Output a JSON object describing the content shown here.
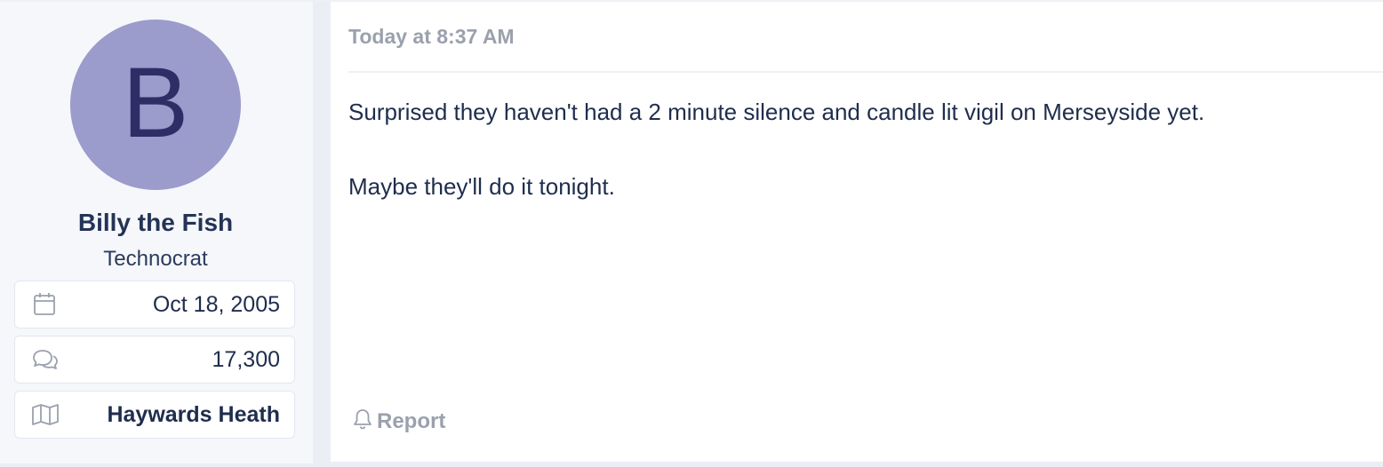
{
  "user": {
    "avatar_letter": "B",
    "avatar_color": "#9b9bcc",
    "name": "Billy the Fish",
    "title": "Technocrat",
    "stats": [
      {
        "icon": "calendar-icon",
        "value": "Oct 18, 2005"
      },
      {
        "icon": "messages-icon",
        "value": "17,300"
      },
      {
        "icon": "map-icon",
        "value": "Haywards Heath"
      }
    ]
  },
  "post": {
    "timestamp": "Today at 8:37 AM",
    "paragraphs": [
      "Surprised they haven't had a 2 minute silence and candle lit vigil on Merseyside yet.",
      "Maybe they'll do it tonight."
    ],
    "report_label": "Report"
  }
}
